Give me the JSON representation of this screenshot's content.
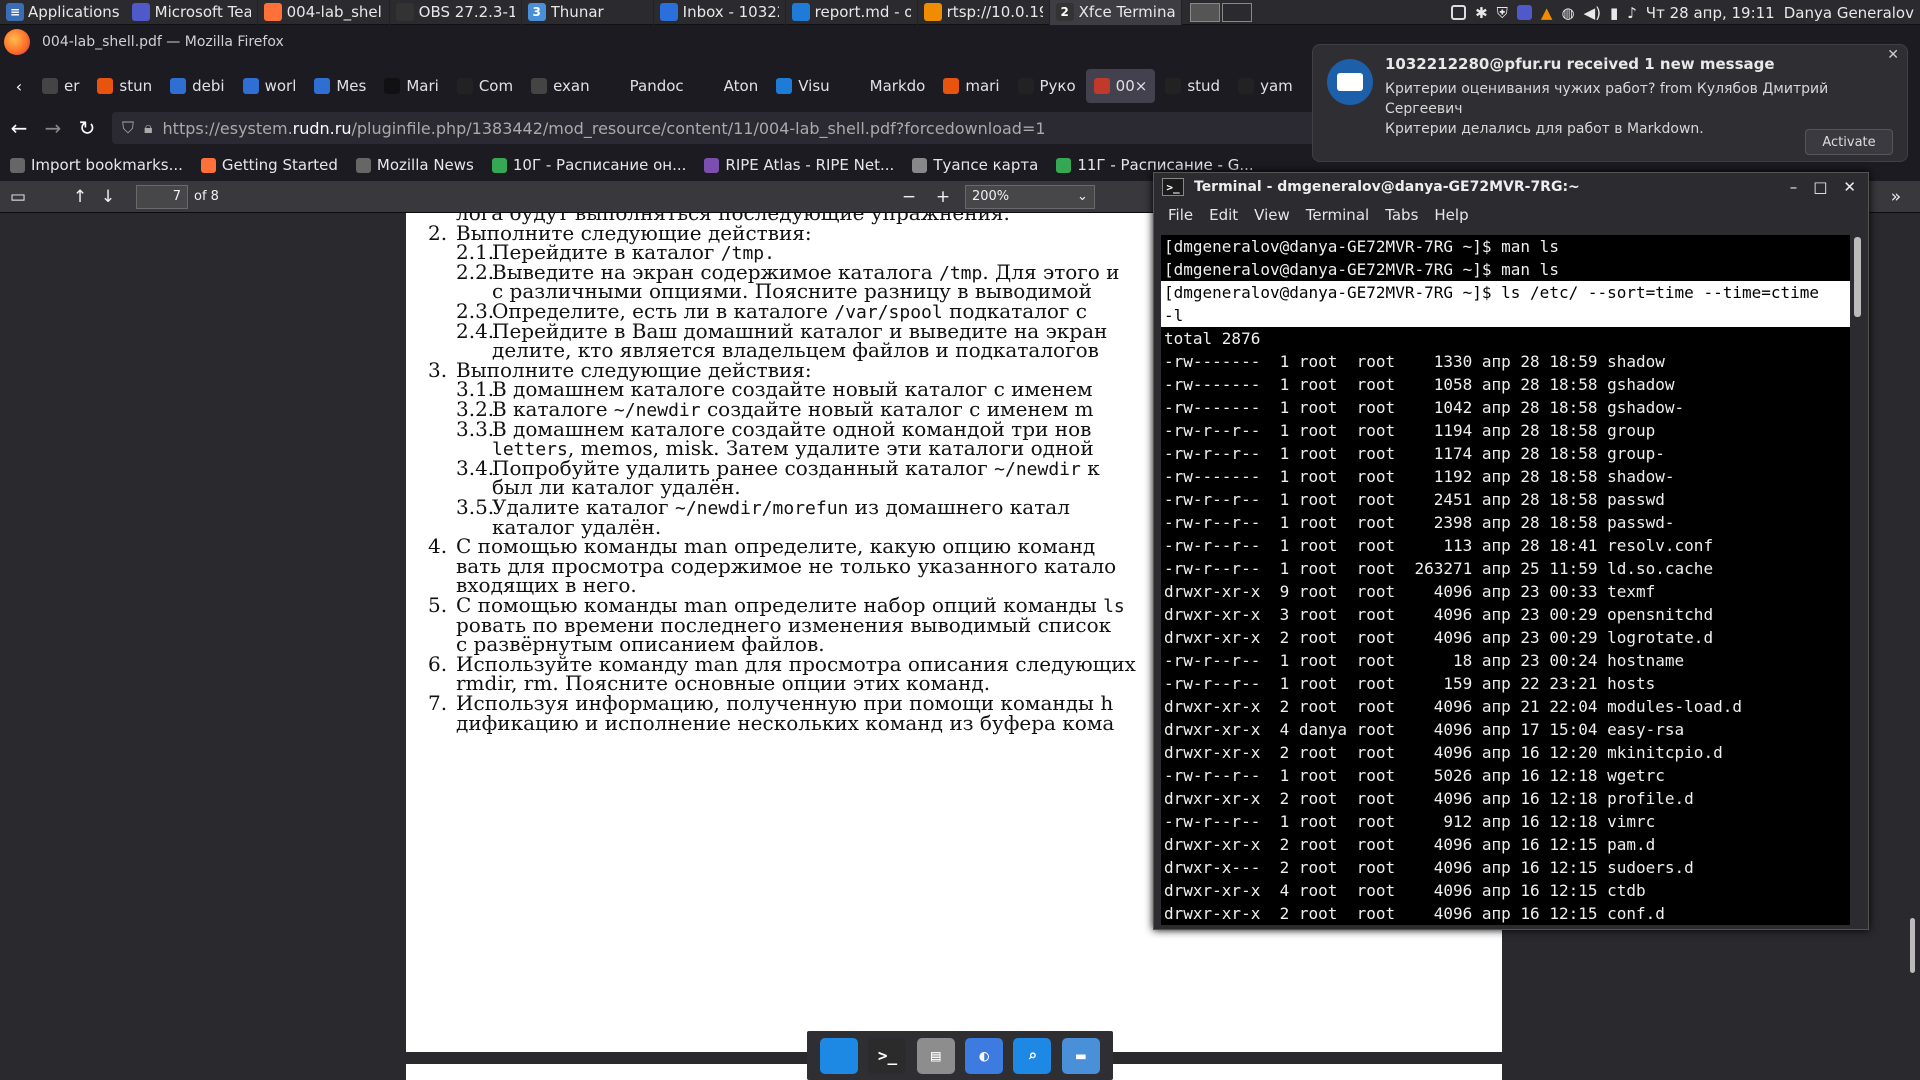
{
  "xfce_panel": {
    "applications_label": "Applications",
    "tasks": [
      {
        "label": "Microsoft Tea...",
        "color": "#5059c9"
      },
      {
        "label": "004-lab_shell....",
        "color": "#ff7139"
      },
      {
        "label": "OBS 27.2.3-1 (...",
        "color": "#333333"
      },
      {
        "label": "Thunar",
        "color": "#4a90d9",
        "badge": "3"
      },
      {
        "label": "Inbox - 10322...",
        "color": "#2a6fdb"
      },
      {
        "label": "report.md - o...",
        "color": "#1e7bd6"
      },
      {
        "label": "rtsp://10.0.19...",
        "color": "#f08c00"
      },
      {
        "label": "Xfce Terminal",
        "color": "#333333",
        "badge": "2",
        "active": true
      }
    ],
    "clock": "Чт 28 апр, 19:11",
    "user": "Danya Generalov"
  },
  "firefox": {
    "window_title": "004-lab_shell.pdf — Mozilla Firefox",
    "tabs": [
      {
        "label": "er",
        "icon": "back-icon",
        "color": "#444444"
      },
      {
        "label": "stun",
        "color": "#e8540d"
      },
      {
        "label": "debi",
        "color": "#2f6ed3"
      },
      {
        "label": "worl",
        "color": "#2f6ed3"
      },
      {
        "label": "Mes",
        "color": "#2f6ed3"
      },
      {
        "label": "Mari",
        "color": "#111111"
      },
      {
        "label": "Com",
        "color": "#222222"
      },
      {
        "label": "exan",
        "color": "#444444"
      },
      {
        "label": "Pandoc",
        "color": "#1c1b22"
      },
      {
        "label": "Aton",
        "color": "#1c1b22"
      },
      {
        "label": "Visu",
        "color": "#1e7bd6"
      },
      {
        "label": "Markdo",
        "color": "#1c1b22"
      },
      {
        "label": "mari",
        "color": "#e8540d"
      },
      {
        "label": "Руко",
        "color": "#222222"
      },
      {
        "label": "00×",
        "color": "#c0392b",
        "selected": true
      },
      {
        "label": "stud",
        "color": "#222222"
      },
      {
        "label": "yam",
        "color": "#222222"
      }
    ],
    "url_prefix": "https://esystem.",
    "url_host": "rudn.ru",
    "url_rest": "/pluginfile.php/1383442/mod_resource/content/11/004-lab_shell.pdf?forcedownload=1",
    "bookmarks": [
      {
        "label": "Import bookmarks...",
        "color": "#666666"
      },
      {
        "label": "Getting Started",
        "color": "#ff7139"
      },
      {
        "label": "Mozilla News",
        "color": "#666666"
      },
      {
        "label": "10Г - Расписание он...",
        "color": "#34a853"
      },
      {
        "label": "RIPE Atlas - RIPE Net...",
        "color": "#7a4fb0"
      },
      {
        "label": "Туапсе карта",
        "color": "#888888"
      },
      {
        "label": "11Г - Расписание - G...",
        "color": "#34a853"
      }
    ]
  },
  "pdf_toolbar": {
    "page_number": "7",
    "page_count": "of 8",
    "zoom": "200%"
  },
  "pdf_page": {
    "lines": [
      {
        "num": "",
        "text": "лога будут выполняться последующие упражнения.",
        "mono": "",
        "indent": 1
      },
      {
        "num": "2.",
        "text": "Выполните следующие действия:",
        "mono": "",
        "indent": 1
      },
      {
        "num": "2.1.",
        "text": "Перейдите в каталог ",
        "mono": "/tmp.",
        "indent": 2
      },
      {
        "num": "2.2.",
        "text": "Выведите на экран содержимое каталога ",
        "mono": "/tmp",
        "tail": ". Для этого и",
        "indent": 2
      },
      {
        "num": "",
        "text": "с различными опциями. Поясните разницу в выводимой",
        "mono": "",
        "indent": 2
      },
      {
        "num": "2.3.",
        "text": "Определите, есть ли в каталоге ",
        "mono": "/var/spool",
        "tail": " подкаталог с",
        "indent": 2
      },
      {
        "num": "2.4.",
        "text": "Перейдите в Ваш домашний каталог и выведите на экран",
        "mono": "",
        "indent": 2
      },
      {
        "num": "",
        "text": "делите, кто является владельцем файлов и подкаталогов",
        "mono": "",
        "indent": 2
      },
      {
        "num": "3.",
        "text": "Выполните следующие действия:",
        "mono": "",
        "indent": 1
      },
      {
        "num": "3.1.",
        "text": "В домашнем каталоге создайте новый каталог с именем",
        "mono": "",
        "indent": 2
      },
      {
        "num": "3.2.",
        "text": "В каталоге ",
        "mono": "~/newdir",
        "tail": " создайте новый каталог с именем m",
        "indent": 2
      },
      {
        "num": "3.3.",
        "text": "В домашнем каталоге создайте одной командой три нов",
        "mono": "",
        "indent": 2
      },
      {
        "num": "",
        "text": "",
        "mono": "letters",
        "tail": ", memos, misk. Затем удалите эти каталоги одной",
        "indent": 2
      },
      {
        "num": "3.4.",
        "text": "Попробуйте удалить ранее созданный каталог ",
        "mono": "~/newdir",
        "tail": " к",
        "indent": 2
      },
      {
        "num": "",
        "text": "был ли каталог удалён.",
        "mono": "",
        "indent": 2
      },
      {
        "num": "3.5.",
        "text": "Удалите каталог ",
        "mono": "~/newdir/morefun",
        "tail": " из домашнего катал",
        "indent": 2
      },
      {
        "num": "",
        "text": "каталог удалён.",
        "mono": "",
        "indent": 2
      },
      {
        "num": "4.",
        "text": "С помощью команды man определите, какую опцию команд",
        "mono": "",
        "indent": 1
      },
      {
        "num": "",
        "text": "вать для просмотра содержимое не только указанного катало",
        "mono": "",
        "indent": 1
      },
      {
        "num": "",
        "text": "входящих в него.",
        "mono": "",
        "indent": 1
      },
      {
        "num": "5.",
        "text": "С помощью команды man определите набор опций команды ",
        "mono": "ls",
        "indent": 1
      },
      {
        "num": "",
        "text": "ровать по времени последнего изменения выводимый список",
        "mono": "",
        "indent": 1
      },
      {
        "num": "",
        "text": "с развёрнутым описанием файлов.",
        "mono": "",
        "indent": 1
      },
      {
        "num": "6.",
        "text": "Используйте команду man для просмотра описания следующих",
        "mono": "",
        "indent": 1
      },
      {
        "num": "",
        "text": "rmdir, rm. Поясните основные опции этих команд.",
        "mono": "",
        "indent": 1
      },
      {
        "num": "7.",
        "text": "Используя информацию, полученную при помощи команды h",
        "mono": "",
        "indent": 1
      },
      {
        "num": "",
        "text": "дификацию и исполнение нескольких команд из буфера кома",
        "mono": "",
        "indent": 1
      }
    ]
  },
  "notification": {
    "title": "1032212280@pfur.ru received 1 new message",
    "body_line1": "Критерии оценивания чужих работ? from Кулябов Дмитрий Сергеевич",
    "body_line2": "Критерии делались для работ в Markdown.",
    "action_label": "Activate",
    "close_label": "✕"
  },
  "terminal": {
    "title": "Terminal - dmgeneralov@danya-GE72MVR-7RG:~",
    "menu": [
      "File",
      "Edit",
      "View",
      "Terminal",
      "Tabs",
      "Help"
    ],
    "lines": [
      {
        "text": "[dmgeneralov@danya-GE72MVR-7RG ~]$ man ls",
        "hl": false
      },
      {
        "text": "[dmgeneralov@danya-GE72MVR-7RG ~]$ man ls",
        "hl": false
      },
      {
        "text": "[dmgeneralov@danya-GE72MVR-7RG ~]$ ls /etc/ --sort=time --time=ctime",
        "hl": true
      },
      {
        "text": "-l",
        "hl": true
      },
      {
        "text": "total 2876",
        "hl": false
      },
      {
        "text": "-rw-------  1 root  root    1330 апр 28 18:59 shadow",
        "hl": false
      },
      {
        "text": "-rw-------  1 root  root    1058 апр 28 18:58 gshadow",
        "hl": false
      },
      {
        "text": "-rw-------  1 root  root    1042 апр 28 18:58 gshadow-",
        "hl": false
      },
      {
        "text": "-rw-r--r--  1 root  root    1194 апр 28 18:58 group",
        "hl": false
      },
      {
        "text": "-rw-r--r--  1 root  root    1174 апр 28 18:58 group-",
        "hl": false
      },
      {
        "text": "-rw-------  1 root  root    1192 апр 28 18:58 shadow-",
        "hl": false
      },
      {
        "text": "-rw-r--r--  1 root  root    2451 апр 28 18:58 passwd",
        "hl": false
      },
      {
        "text": "-rw-r--r--  1 root  root    2398 апр 28 18:58 passwd-",
        "hl": false
      },
      {
        "text": "-rw-r--r--  1 root  root     113 апр 28 18:41 resolv.conf",
        "hl": false
      },
      {
        "text": "-rw-r--r--  1 root  root  263271 апр 25 11:59 ld.so.cache",
        "hl": false
      },
      {
        "text": "drwxr-xr-x  9 root  root    4096 апр 23 00:33 texmf",
        "hl": false
      },
      {
        "text": "drwxr-xr-x  3 root  root    4096 апр 23 00:29 opensnitchd",
        "hl": false
      },
      {
        "text": "drwxr-xr-x  2 root  root    4096 апр 23 00:29 logrotate.d",
        "hl": false
      },
      {
        "text": "-rw-r--r--  1 root  root      18 апр 23 00:24 hostname",
        "hl": false
      },
      {
        "text": "-rw-r--r--  1 root  root     159 апр 22 23:21 hosts",
        "hl": false
      },
      {
        "text": "drwxr-xr-x  2 root  root    4096 апр 21 22:04 modules-load.d",
        "hl": false
      },
      {
        "text": "drwxr-xr-x  4 danya root    4096 апр 17 15:04 easy-rsa",
        "hl": false
      },
      {
        "text": "drwxr-xr-x  2 root  root    4096 апр 16 12:20 mkinitcpio.d",
        "hl": false
      },
      {
        "text": "-rw-r--r--  1 root  root    5026 апр 16 12:18 wgetrc",
        "hl": false
      },
      {
        "text": "drwxr-xr-x  2 root  root    4096 апр 16 12:18 profile.d",
        "hl": false
      },
      {
        "text": "-rw-r--r--  1 root  root     912 апр 16 12:18 vimrc",
        "hl": false
      },
      {
        "text": "drwxr-xr-x  2 root  root    4096 апр 16 12:15 pam.d",
        "hl": false
      },
      {
        "text": "drwxr-x---  2 root  root    4096 апр 16 12:15 sudoers.d",
        "hl": false
      },
      {
        "text": "drwxr-xr-x  4 root  root    4096 апр 16 12:15 ctdb",
        "hl": false
      },
      {
        "text": "drwxr-xr-x  2 root  root    4096 апр 16 12:15 conf.d",
        "hl": false
      }
    ]
  },
  "dock": [
    {
      "icon": "desktop-icon",
      "color": "#1e88e5",
      "glyph": ""
    },
    {
      "icon": "terminal-icon",
      "color": "#2b2b2b",
      "glyph": ">_"
    },
    {
      "icon": "files-icon",
      "color": "#8d8d8d",
      "glyph": "▤"
    },
    {
      "icon": "browser-icon",
      "color": "#3d7be0",
      "glyph": "◐"
    },
    {
      "icon": "search-icon",
      "color": "#1e88e5",
      "glyph": "⌕"
    },
    {
      "icon": "folder-icon",
      "color": "#4a90d9",
      "glyph": "▬"
    }
  ]
}
